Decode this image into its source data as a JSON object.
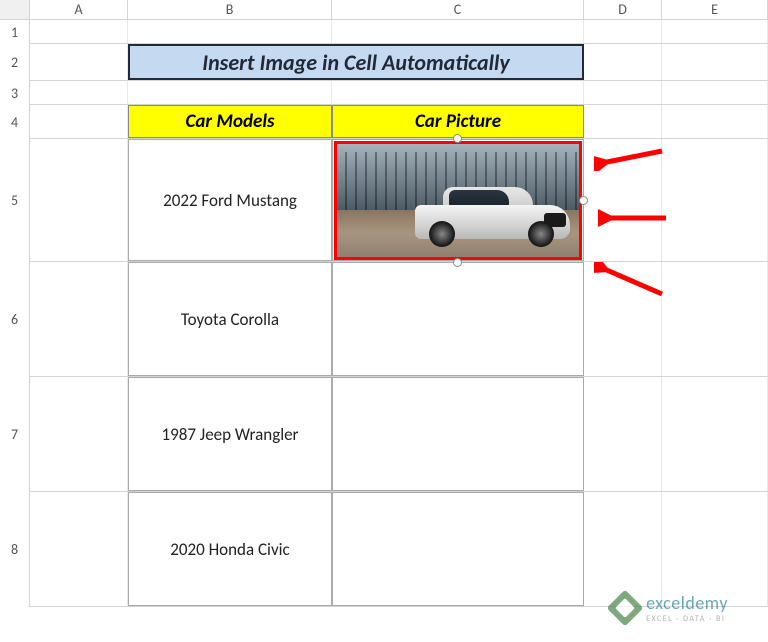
{
  "columns": [
    "A",
    "B",
    "C",
    "D",
    "E"
  ],
  "rows": [
    "1",
    "2",
    "3",
    "4",
    "5",
    "6",
    "7",
    "8"
  ],
  "title": "Insert Image in Cell Automatically",
  "headers": {
    "models": "Car Models",
    "picture": "Car Picture"
  },
  "data": {
    "r5": "2022 Ford Mustang",
    "r6": "Toyota Corolla",
    "r7": "1987 Jeep Wrangler",
    "r8": "2020 Honda Civic"
  },
  "watermark": {
    "title": "exceldemy",
    "subtitle": "EXCEL · DATA · BI"
  }
}
